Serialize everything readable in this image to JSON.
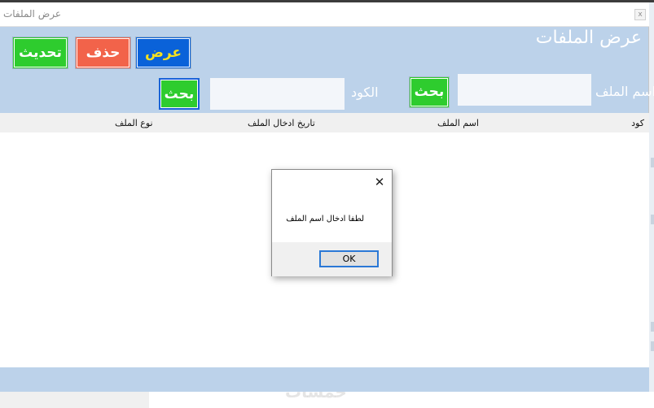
{
  "window": {
    "title": "عرض الملفات",
    "close_glyph": "x"
  },
  "header": {
    "heading": "عرض الملفات"
  },
  "toolbar": {
    "view_label": "عرض",
    "delete_label": "حذف",
    "refresh_label": "تحديث"
  },
  "search": {
    "name_label": "اسم الملف",
    "name_value": "",
    "name_button": "بحث",
    "code_label": "الكود",
    "code_value": "",
    "code_button": "بحث"
  },
  "grid": {
    "columns": [
      "كود",
      "اسم الملف",
      "تاريخ ادخال الملف",
      "نوع الملف"
    ]
  },
  "dialog": {
    "close_glyph": "✕",
    "message": "لطفا ادخال اسم الملف",
    "ok_label": "OK"
  },
  "colors": {
    "panel": "#bcd2ea",
    "refresh": "#2ecc2e",
    "delete": "#f2634a",
    "view": "#0a62d9",
    "view_text": "#f5e11e"
  },
  "icons": {
    "window_close": "close-icon",
    "dialog_close": "close-icon"
  }
}
